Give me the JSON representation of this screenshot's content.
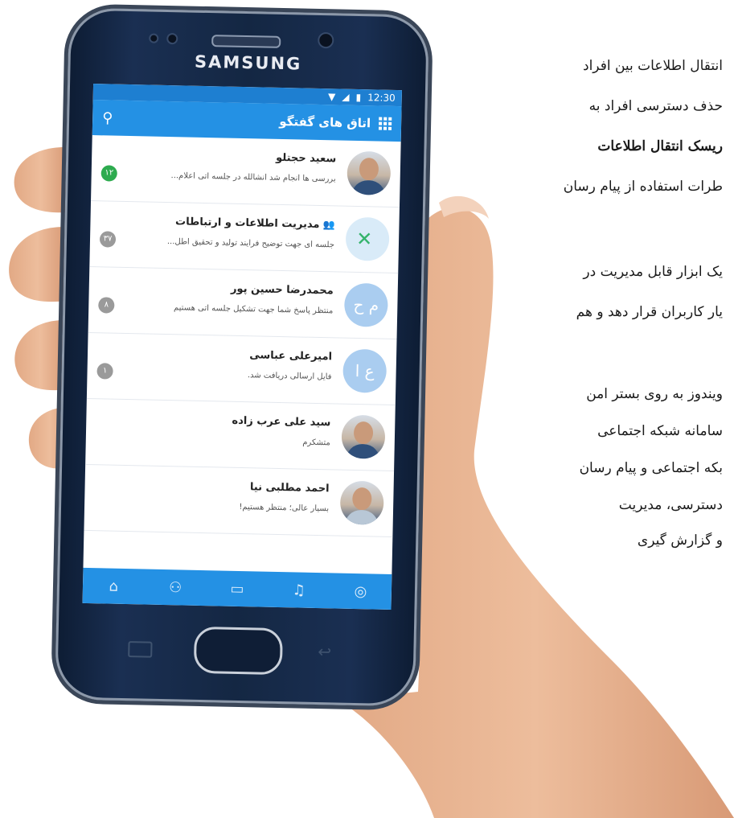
{
  "side_text": [
    {
      "text": "انتقال اطلاعات بین افراد",
      "bold": false
    },
    {
      "text": "حذف دسترسی افراد به",
      "bold": false
    },
    {
      "text": "ریسک انتقال اطلاعات",
      "bold": true
    },
    {
      "text": "طرات استفاده از پیام رسان",
      "bold": false
    },
    {
      "text": "یک ابزار قابل مدیریت در",
      "bold": false
    },
    {
      "text": "یار کاربران قرار دهد و هم",
      "bold": false
    },
    {
      "text": "ویندوز به روی بستر امن",
      "bold": false
    },
    {
      "text": "سامانه شبکه اجتماعی",
      "bold": false
    },
    {
      "text": "بکه اجتماعی و پیام رسان",
      "bold": false
    },
    {
      "text": "دسترسی، مدیریت",
      "bold": false
    },
    {
      "text": "و گزارش گیری",
      "bold": false
    }
  ],
  "phone": {
    "brand": "SAMSUNG",
    "status_time": "12:30",
    "appbar_title": "اتاق های گفتگو"
  },
  "icons": {
    "search": "search-icon",
    "menu": "grid-menu-icon",
    "home": "home-icon",
    "contacts": "contacts-icon",
    "chat": "chat-icon",
    "notifications": "bell-icon",
    "profile": "profile-icon"
  },
  "colors": {
    "appbar": "#2491e4",
    "statusbar": "#1e7fd1",
    "badge_green": "#2eab4f",
    "badge_gray": "#9a9a9a"
  },
  "chats": [
    {
      "name": "سعید حجتلو",
      "preview": "بررسی ها انجام شد انشالله در جلسه آتی اعلام...",
      "badge": "۱۲",
      "badge_color": "green",
      "avatar": "photo",
      "avatar_text": ""
    },
    {
      "name": "مدیریت اطلاعات و ارتباطات",
      "preview": "جلسه ای جهت توضیح فرآیند تولید و تحقیق اطل...",
      "badge": "۳۷",
      "badge_color": "gray",
      "avatar": "logo",
      "avatar_text": ""
    },
    {
      "name": "محمدرضا حسین پور",
      "preview": "منتظر پاسخ شما جهت تشکیل جلسه آتی هستیم",
      "badge": "۸",
      "badge_color": "gray",
      "avatar": "initials",
      "avatar_text": "م ح"
    },
    {
      "name": "امیرعلی عباسی",
      "preview": "فایل ارسالی دریافت شد.",
      "badge": "۱",
      "badge_color": "gray",
      "avatar": "initials",
      "avatar_text": "ع ا"
    },
    {
      "name": "سید علی عرب زاده",
      "preview": "متشکرم",
      "badge": "",
      "badge_color": "",
      "avatar": "photo",
      "avatar_text": ""
    },
    {
      "name": "احمد مطلبی نیا",
      "preview": "بسیار عالی؛ منتظر هستیم!",
      "badge": "",
      "badge_color": "",
      "avatar": "photo",
      "avatar_text": ""
    }
  ]
}
